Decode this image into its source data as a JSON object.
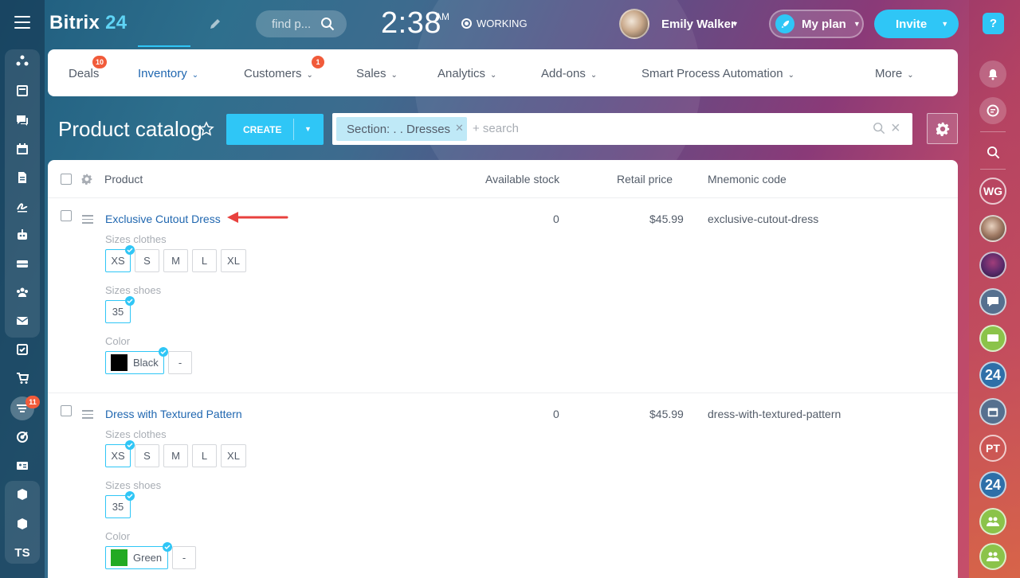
{
  "header": {
    "brand_name": "Bitrix",
    "brand_number": "24",
    "search_placeholder": "find p...",
    "time": "2:38",
    "ampm": "AM",
    "work_status": "WORKING",
    "user_name": "Emily Walker",
    "plan_label": "My plan",
    "invite_label": "Invite"
  },
  "sidebar": {
    "badge_count": "11",
    "initials": "TS"
  },
  "rightbar": {
    "help": "?",
    "contacts": [
      {
        "initials": "WG",
        "color": "#e35d3a"
      },
      {
        "initials": "24",
        "color": "#2e6fa8"
      },
      {
        "initials": "PT",
        "color": "#8bc34a"
      },
      {
        "initials": "24",
        "color": "#2e6fa8"
      }
    ]
  },
  "nav": {
    "items": [
      {
        "label": "Deals",
        "badge": "10"
      },
      {
        "label": "Inventory"
      },
      {
        "label": "Customers",
        "badge": "1"
      },
      {
        "label": "Sales"
      },
      {
        "label": "Analytics"
      },
      {
        "label": "Add-ons"
      },
      {
        "label": "Smart Process Automation"
      },
      {
        "label": "More"
      }
    ]
  },
  "toolbar": {
    "title": "Product catalog",
    "create_label": "CREATE",
    "filter_chip": "Section: . . Dresses",
    "search_placeholder": "+ search"
  },
  "table": {
    "columns": [
      "Product",
      "Available stock",
      "Retail price",
      "Mnemonic code"
    ],
    "rows": [
      {
        "name": "Exclusive Cutout Dress",
        "stock": "0",
        "price": "$45.99",
        "code": "exclusive-cutout-dress",
        "sizes_clothes_label": "Sizes clothes",
        "sizes_clothes": [
          "XS",
          "S",
          "M",
          "L",
          "XL"
        ],
        "sizes_shoes_label": "Sizes shoes",
        "sizes_shoes": [
          "35"
        ],
        "color_label": "Color",
        "color_name": "Black",
        "color_hex": "#000000",
        "color_empty": "-"
      },
      {
        "name": "Dress with Textured Pattern",
        "stock": "0",
        "price": "$45.99",
        "code": "dress-with-textured-pattern",
        "sizes_clothes_label": "Sizes clothes",
        "sizes_clothes": [
          "XS",
          "S",
          "M",
          "L",
          "XL"
        ],
        "sizes_shoes_label": "Sizes shoes",
        "sizes_shoes": [
          "35"
        ],
        "color_label": "Color",
        "color_name": "Green",
        "color_hex": "#22aa22",
        "color_empty": "-"
      }
    ]
  },
  "colors": {
    "accent": "#2fc6f6",
    "link": "#2067b0",
    "badge": "#f15b3a",
    "annotation_arrow": "#e8413e"
  }
}
